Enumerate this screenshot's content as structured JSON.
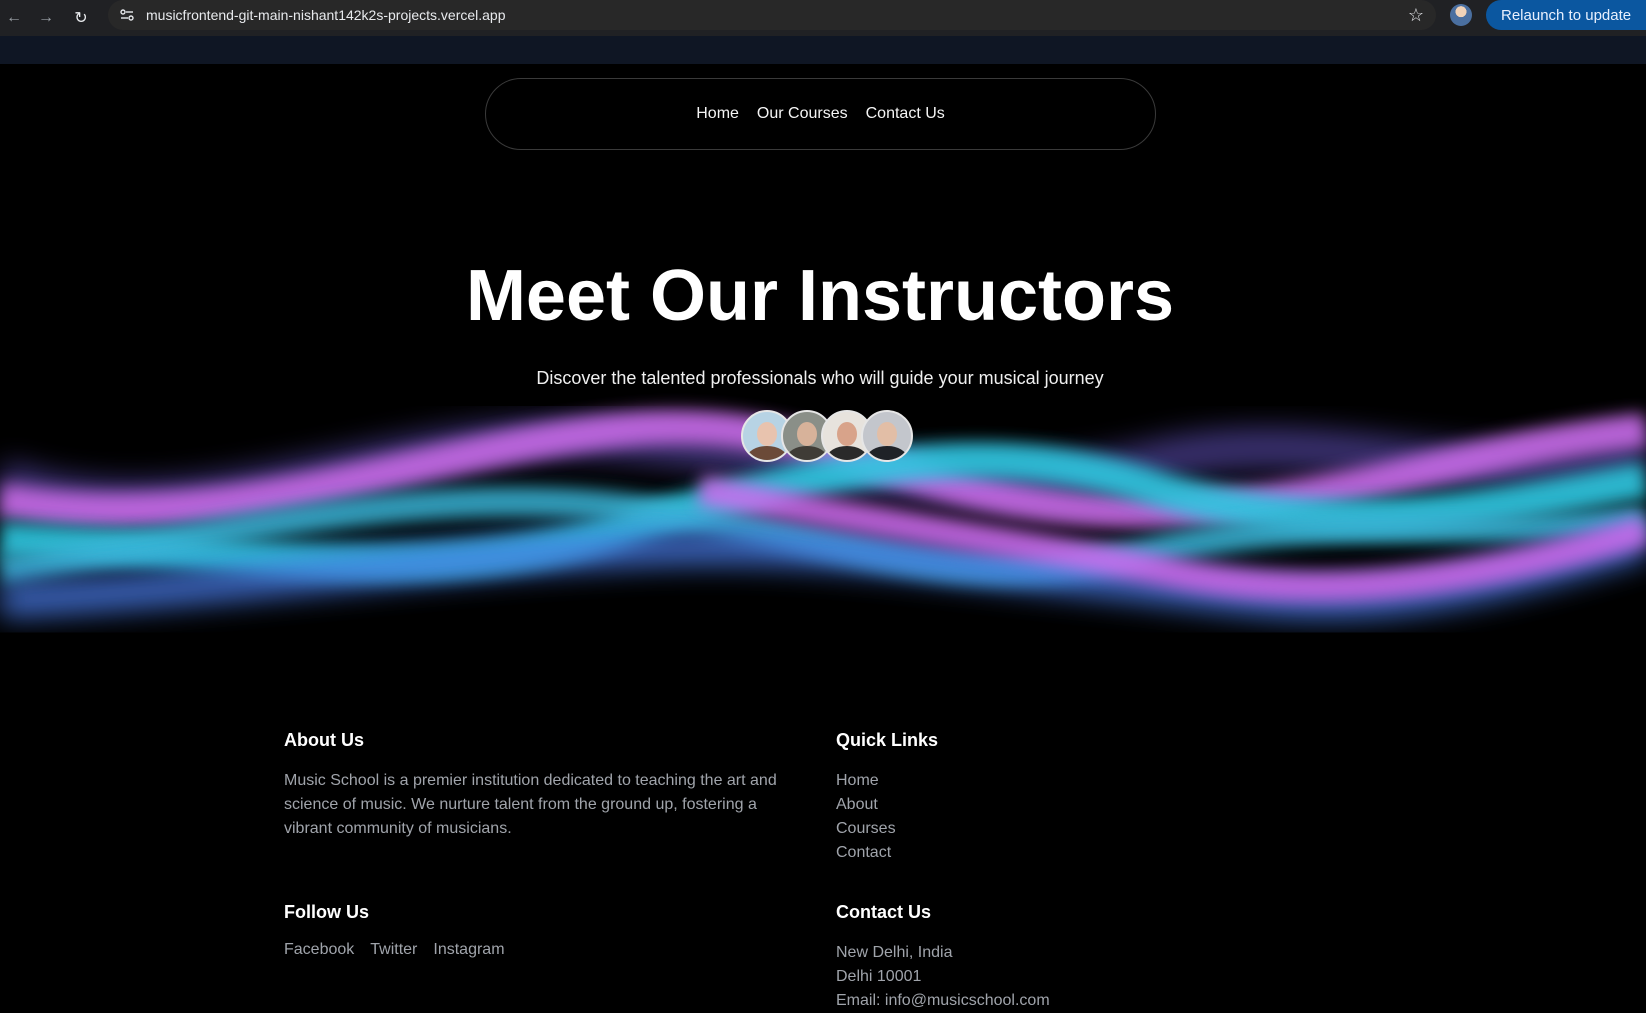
{
  "browser": {
    "url": "musicfrontend-git-main-nishant142k2s-projects.vercel.app",
    "relaunch_label": "Relaunch to update"
  },
  "nav": {
    "items": [
      {
        "label": "Home"
      },
      {
        "label": "Our Courses"
      },
      {
        "label": "Contact Us"
      }
    ]
  },
  "hero": {
    "title": "Meet Our Instructors",
    "subtitle": "Discover the talented professionals who will guide your musical journey"
  },
  "footer": {
    "about": {
      "heading": "About Us",
      "text": "Music School is a premier institution dedicated to teaching the art and science of music. We nurture talent from the ground up, fostering a vibrant community of musicians."
    },
    "quick_links": {
      "heading": "Quick Links",
      "items": [
        "Home",
        "About",
        "Courses",
        "Contact"
      ]
    },
    "follow": {
      "heading": "Follow Us",
      "items": [
        "Facebook",
        "Twitter",
        "Instagram"
      ]
    },
    "contact": {
      "heading": "Contact Us",
      "lines": [
        "New Delhi, India",
        "Delhi 10001",
        "Email: info@musicschool.com"
      ]
    }
  },
  "colors": {
    "wave_cyan": "#2fc7e0",
    "wave_pink": "#d06cf0",
    "wave_blue": "#4a7be8"
  }
}
